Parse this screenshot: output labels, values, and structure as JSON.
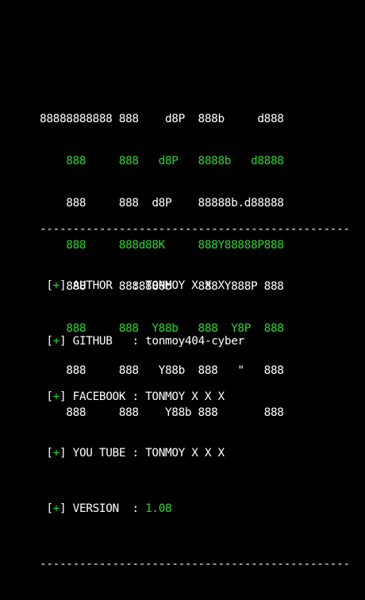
{
  "colors": {
    "background": "#000000",
    "white": "#ffffff",
    "green": "#2fd42f"
  },
  "banner": {
    "lines": [
      {
        "text": "88888888888 888    d8P  888b     d888",
        "color": "white"
      },
      {
        "text": "    888     888   d8P   8888b   d8888",
        "color": "green"
      },
      {
        "text": "    888     888  d8P    88888b.d88888",
        "color": "white"
      },
      {
        "text": "    888     888d88K     888Y88888P888",
        "color": "green"
      },
      {
        "text": "    888     8888888b    888 Y888P 888",
        "color": "white"
      },
      {
        "text": "    888     888  Y88b   888  Y8P  888",
        "color": "green"
      },
      {
        "text": "    888     888   Y88b  888   \"   888",
        "color": "white"
      },
      {
        "text": "    888     888    Y88b 888       888",
        "color": "white"
      }
    ]
  },
  "info": {
    "divider": "-----------------------------------------------",
    "bracket_open": "[",
    "bracket_plus": "+",
    "bracket_close": "]",
    "rows": [
      {
        "label": "AUTHOR  ",
        "sep": " : ",
        "value": "TONMOY X X X",
        "value_color": "white"
      },
      {
        "label": "GITHUB  ",
        "sep": " : ",
        "value": "tonmoy404-cyber",
        "value_color": "white"
      },
      {
        "label": "FACEBOOK",
        "sep": " : ",
        "value": "TONMOY X X X",
        "value_color": "white"
      },
      {
        "label": "YOU TUBE",
        "sep": " : ",
        "value": "TONMOY X X X",
        "value_color": "white"
      },
      {
        "label": "VERSION ",
        "sep": " : ",
        "value": "1.08",
        "value_color": "green"
      }
    ]
  }
}
